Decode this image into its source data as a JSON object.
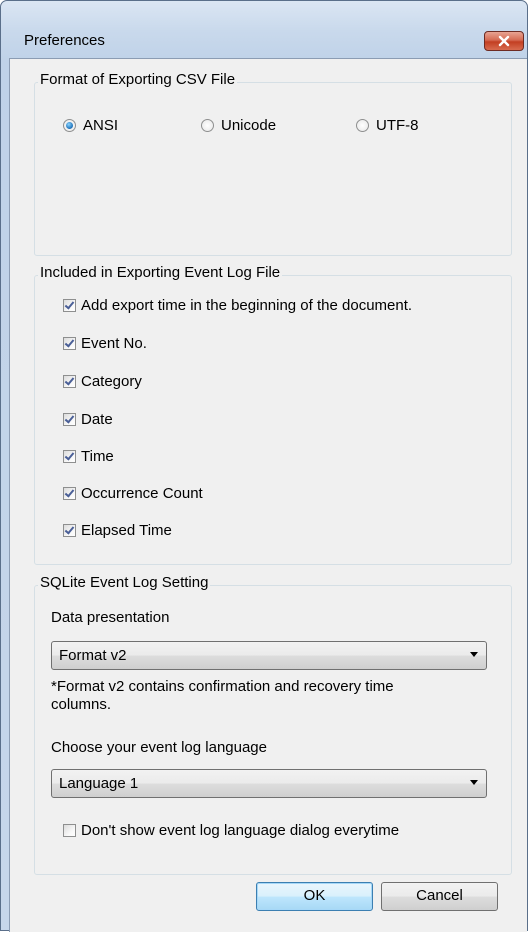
{
  "window": {
    "title": "Preferences"
  },
  "csv_format": {
    "group_title": "Format of Exporting CSV File",
    "options": [
      "ANSI",
      "Unicode",
      "UTF-8"
    ],
    "selected": "ANSI"
  },
  "event_log_export": {
    "group_title": "Included in Exporting Event Log File",
    "items": [
      {
        "label": "Add export time in the beginning of the document.",
        "checked": true
      },
      {
        "label": "Event No.",
        "checked": true
      },
      {
        "label": "Category",
        "checked": true
      },
      {
        "label": "Date",
        "checked": true
      },
      {
        "label": "Time",
        "checked": true
      },
      {
        "label": "Occurrence Count",
        "checked": true
      },
      {
        "label": "Elapsed Time",
        "checked": true
      }
    ]
  },
  "sqlite": {
    "group_title": "SQLite Event Log Setting",
    "presentation_label": "Data presentation",
    "presentation_value": "Format v2",
    "note_line1": "*Format v2 contains confirmation and recovery time",
    "note_line2": "columns.",
    "language_label": "Choose your event log language",
    "language_value": "Language 1",
    "dont_show_label": "Don't show event log language dialog everytime",
    "dont_show_checked": false
  },
  "buttons": {
    "ok": "OK",
    "cancel": "Cancel"
  },
  "colors": {
    "client_bg": "#f0f0f0",
    "close_button": "#c33f22",
    "default_button_border": "#3c7fb1"
  },
  "icons": {
    "close": "close-icon",
    "dropdown": "chevron-down-icon"
  }
}
